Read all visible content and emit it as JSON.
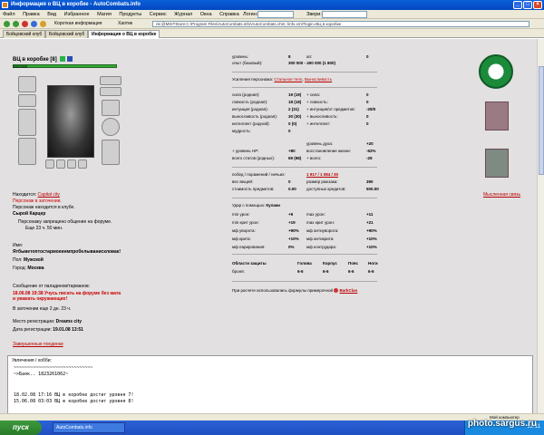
{
  "window": {
    "title": "Информация о ВЦ в коробке - AutoCombats.info"
  },
  "menu": {
    "items": [
      "Файл",
      "Правка",
      "Вид",
      "Избранное",
      "Магия",
      "Продукты",
      "Сервис",
      "Журнал",
      "Окна",
      "Справка"
    ],
    "login_label": "Логин:",
    "beast_label": "Звери:"
  },
  "toolbar": {
    "short_info": "Короткая информация",
    "macros": "Хаотик",
    "address": "nk:@MSITStore:C:\\Program Files\\AutoCombats.info\\AutoCombats.chm::/info.xml?login=ВЦ в коробке"
  },
  "tabs": [
    "Бойцовский клуб",
    "Бойцовский клуб",
    "Информация о ВЦ в коробке"
  ],
  "character": {
    "name": "ВЦ в коробке",
    "level": "[8]",
    "hp": "260/260",
    "location_label": "Находится:",
    "location_value": "Capital city",
    "prison": "Персонаж в заточении.",
    "club_status": "Персонаж находится в клубе.",
    "room": "Сырой Карцер",
    "forum_ban": "Персонажу запрещено общение на форуме.",
    "forum_ban_time": "Еще 23 ч. 50 мин.",
    "name_label": "Имя:",
    "full_name": "Ятбыветоптостармоеинмпробелыванискловак!",
    "gender_label": "Пол:",
    "gender": "Мужской",
    "city_label": "Город:",
    "city": "Москва",
    "paladin_msg_label": "Сообщение от паладинов/тарманов:",
    "paladin_msg": "18.06.08 19:38 Учусь писать на форуме без мата и уважать окружающих!",
    "prison_time": "В заточении еще 2 дн. 23 ч.",
    "reg_place_label": "Место регистрации:",
    "reg_place": "Dreams city",
    "reg_date_label": "Дата регистрации:",
    "reg_date": "19.01.08 13:51",
    "quests_link": "Завершенные поединки"
  },
  "stats": {
    "level_label": "уровень:",
    "level": "8",
    "ap_label": "ап:",
    "ap": "0",
    "exp_label": "опыт (базовый):",
    "exp": "300 000 - 400 000 (1 800)",
    "boost_label": "Усиления персонажа:",
    "boost_1": "Стальное тело",
    "boost_2": "Выносливость",
    "rows": [
      [
        "сила (родная):",
        "19 (19)",
        "+ сила:",
        "0"
      ],
      [
        "ловкость (родная):",
        "18 (18)",
        "+ ловкость:",
        "0"
      ],
      [
        "интуиция (родная):",
        "2 (31)",
        "+ интуиция/от предметов:",
        "-29/0"
      ],
      [
        "выносливость (родная):",
        "30 (30)",
        "+ выносливость:",
        "0"
      ],
      [
        "интеллект (родной):",
        "0 (0)",
        "+ интеллект:",
        "0"
      ],
      [
        "мудрость:",
        "0",
        "",
        ""
      ]
    ],
    "spirit_label": "уровень духа:",
    "spirit": "+20",
    "hp_label": "+ уровень HP:",
    "hp": "+80",
    "restore_label": "восстановление жизни:",
    "restore": "-52%",
    "total_label": "всего статов (родных):",
    "total": "69 (98)",
    "total_all_label": "+ всего:",
    "total_all": "-29",
    "wins_label": "побед / поражений / ничьих:",
    "wins": "1 917 / 1 084 / 30",
    "weight_label": "вес вещей:",
    "weight": "0",
    "backpack_label": "размер рюкзака:",
    "backpack": "390",
    "cost_label": "стоимость предметов:",
    "cost": "0.00",
    "credits_label": "доступных кредитов:",
    "credits": "500.00",
    "hit_label": "Удар с помощью:",
    "hit": "Кулаки",
    "combat": [
      [
        "min урон:",
        "+9",
        "max урон:",
        "+11"
      ],
      [
        "min крит урон:",
        "+19",
        "max крит урон:",
        "+21"
      ],
      [
        "мф уворота:",
        "+90%",
        "мф антиуворота:",
        "+90%"
      ],
      [
        "мф крита:",
        "+10%",
        "мф антикрита:",
        "+10%"
      ],
      [
        "мф парирования:",
        "0%",
        "мф контрудара:",
        "+10%"
      ]
    ],
    "armor_header": [
      "Области защиты",
      "Голова",
      "Корпус",
      "Пояс",
      "Ноги"
    ],
    "armor_row": [
      "броня:",
      "6-6",
      "6-6",
      "6-6",
      "6-6"
    ],
    "formula_note": "При расчете использовались формулы примерочной",
    "formula_link": "BarkClan"
  },
  "right": {
    "link": "Мысленная связь"
  },
  "hobby": {
    "label": "Увлечения / хобби:",
    "line1": "~~~~~~~~~~~~~~~~~~~~~~~~~~~~~",
    "line2": "~>Баяк.. 1823261062~",
    "line3": "18.02.08 17:16 ВЦ в коробке достиг уровня 7!",
    "line4": "15.06.08 03:03 ВЦ в коробке достиг уровня 8!"
  },
  "statusbar": {
    "text": "Мой компьютер"
  },
  "taskbar": {
    "start": "пуск",
    "task": "AutoCombats.info",
    "clock": "12:11"
  },
  "watermark": "photo.sargus.ru"
}
